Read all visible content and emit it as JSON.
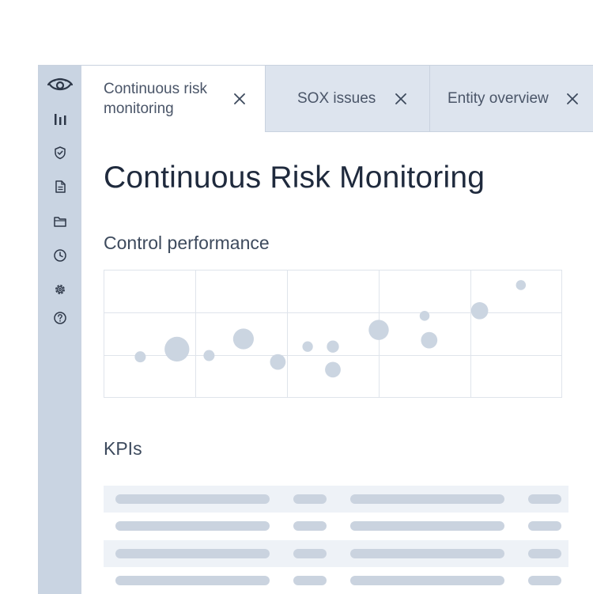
{
  "tabs": [
    {
      "label": "Continuous risk monitoring",
      "active": true
    },
    {
      "label": "SOX issues",
      "active": false
    },
    {
      "label": "Entity overview",
      "active": false
    }
  ],
  "sidebar": {
    "logo_icon": "eye-icon",
    "icons": [
      "bar-chart-icon",
      "shield-check-icon",
      "document-icon",
      "folder-icon",
      "clock-icon",
      "gear-icon",
      "help-icon"
    ]
  },
  "page": {
    "title": "Continuous Risk Monitoring",
    "control_section": "Control performance",
    "kpi_section": "KPIs"
  },
  "colors": {
    "sidebar": "#c9d4e2",
    "bubble": "#cbd5e1",
    "grid": "#dfe4eb",
    "placeholder_bar": "#cad3df"
  },
  "chart_data": {
    "type": "scatter",
    "grid": true,
    "grid_columns": 5,
    "grid_rows": 3,
    "xlim": [
      0,
      100
    ],
    "ylim": [
      0,
      100
    ],
    "points": [
      {
        "x": 8,
        "y": 32,
        "size": 1
      },
      {
        "x": 16,
        "y": 38,
        "size": 5
      },
      {
        "x": 23,
        "y": 33,
        "size": 1
      },
      {
        "x": 30.5,
        "y": 46,
        "size": 3.5
      },
      {
        "x": 38,
        "y": 28,
        "size": 2
      },
      {
        "x": 44.5,
        "y": 40,
        "size": 0.9
      },
      {
        "x": 50,
        "y": 40,
        "size": 1.2
      },
      {
        "x": 50,
        "y": 22,
        "size": 2
      },
      {
        "x": 60,
        "y": 53,
        "size": 3.3
      },
      {
        "x": 70,
        "y": 64,
        "size": 0.8
      },
      {
        "x": 71,
        "y": 45,
        "size": 2.2
      },
      {
        "x": 82,
        "y": 68,
        "size": 2.4
      },
      {
        "x": 91,
        "y": 88,
        "size": 0.8
      }
    ]
  },
  "kpi_rows": 4
}
